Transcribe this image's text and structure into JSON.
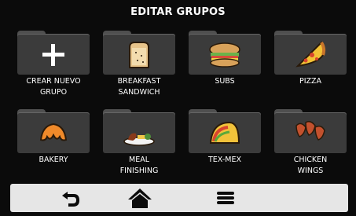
{
  "header": {
    "title": "EDITAR GRUPOS"
  },
  "groups": [
    {
      "label": "CREAR NUEVO\nGRUPO",
      "icon": "plus-icon"
    },
    {
      "label": "BREAKFAST\nSANDWICH",
      "icon": "sandwich-icon"
    },
    {
      "label": "SUBS",
      "icon": "sub-sandwich-icon"
    },
    {
      "label": "PIZZA",
      "icon": "pizza-slice-icon"
    },
    {
      "label": "BAKERY",
      "icon": "croissant-icon"
    },
    {
      "label": "MEAL\nFINISHING",
      "icon": "meal-plate-icon"
    },
    {
      "label": "TEX-MEX",
      "icon": "taco-icon"
    },
    {
      "label": "CHICKEN\nWINGS",
      "icon": "chicken-wings-icon"
    }
  ],
  "navbar": {
    "items": [
      {
        "icon": "back-arrow-icon"
      },
      {
        "icon": "home-icon"
      },
      {
        "icon": "menu-icon"
      }
    ]
  },
  "colors": {
    "background": "#0b0b0b",
    "folder": "#3b3b3b",
    "navbar": "#e6e6e6"
  }
}
